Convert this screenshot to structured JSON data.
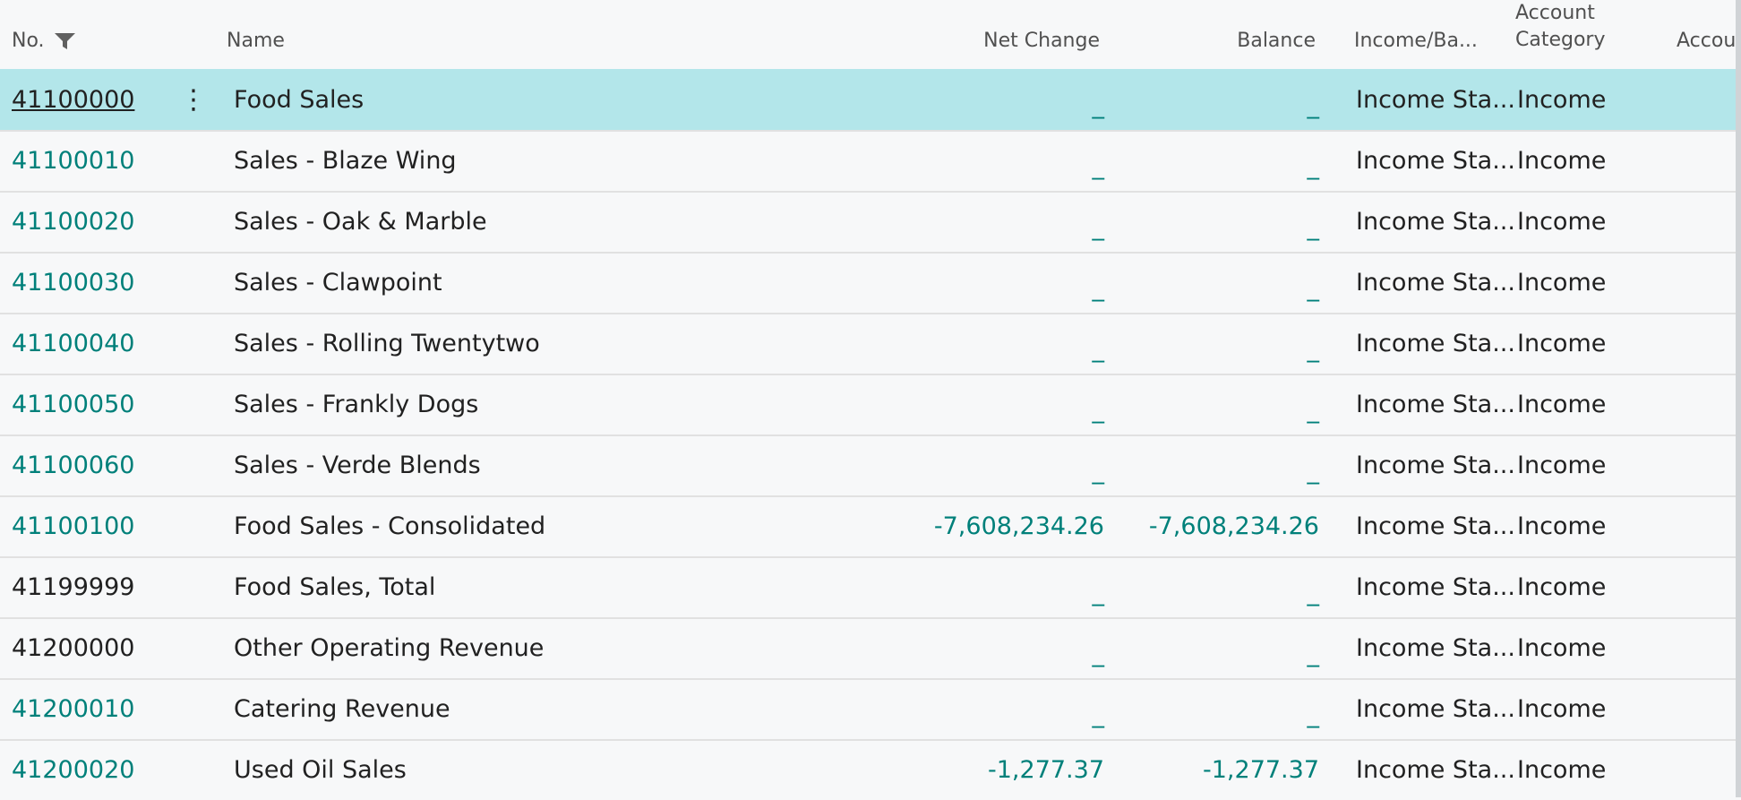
{
  "columns": {
    "no": "No.",
    "name": "Name",
    "net_change": "Net Change",
    "balance": "Balance",
    "income_balance": "Income/Ba...",
    "account_category_line1": "Account",
    "account_category_line2": "Category",
    "account_truncated": "Accou"
  },
  "icons": {
    "filter": "filter-icon",
    "row_menu": "vertical-ellipsis-icon"
  },
  "colors": {
    "link": "#00807a",
    "selected_row": "#b3e6ea"
  },
  "row_menu_glyph": "⋮",
  "rows": [
    {
      "no": "41100000",
      "name": "Food Sales",
      "net_change": "_",
      "balance": "_",
      "income_balance": "Income Sta...",
      "account_category": "Income"
    },
    {
      "no": "41100010",
      "name": "Sales - Blaze Wing",
      "net_change": "_",
      "balance": "_",
      "income_balance": "Income Sta...",
      "account_category": "Income"
    },
    {
      "no": "41100020",
      "name": "Sales - Oak & Marble",
      "net_change": "_",
      "balance": "_",
      "income_balance": "Income Sta...",
      "account_category": "Income"
    },
    {
      "no": "41100030",
      "name": "Sales - Clawpoint",
      "net_change": "_",
      "balance": "_",
      "income_balance": "Income Sta...",
      "account_category": "Income"
    },
    {
      "no": "41100040",
      "name": "Sales - Rolling Twentytwo",
      "net_change": "_",
      "balance": "_",
      "income_balance": "Income Sta...",
      "account_category": "Income"
    },
    {
      "no": "41100050",
      "name": "Sales - Frankly Dogs",
      "net_change": "_",
      "balance": "_",
      "income_balance": "Income Sta...",
      "account_category": "Income"
    },
    {
      "no": "41100060",
      "name": "Sales - Verde Blends",
      "net_change": "_",
      "balance": "_",
      "income_balance": "Income Sta...",
      "account_category": "Income"
    },
    {
      "no": "41100100",
      "name": "Food Sales - Consolidated",
      "net_change": "-7,608,234.26",
      "balance": "-7,608,234.26",
      "income_balance": "Income Sta...",
      "account_category": "Income"
    },
    {
      "no": "41199999",
      "name": "Food Sales, Total",
      "net_change": "_",
      "balance": "_",
      "income_balance": "Income Sta...",
      "account_category": "Income"
    },
    {
      "no": "41200000",
      "name": "Other Operating Revenue",
      "net_change": "_",
      "balance": "_",
      "income_balance": "Income Sta...",
      "account_category": "Income"
    },
    {
      "no": "41200010",
      "name": "Catering Revenue",
      "net_change": "_",
      "balance": "_",
      "income_balance": "Income Sta...",
      "account_category": "Income"
    },
    {
      "no": "41200020",
      "name": "Used Oil Sales",
      "net_change": "-1,277.37",
      "balance": "-1,277.37",
      "income_balance": "Income Sta...",
      "account_category": "Income"
    }
  ]
}
